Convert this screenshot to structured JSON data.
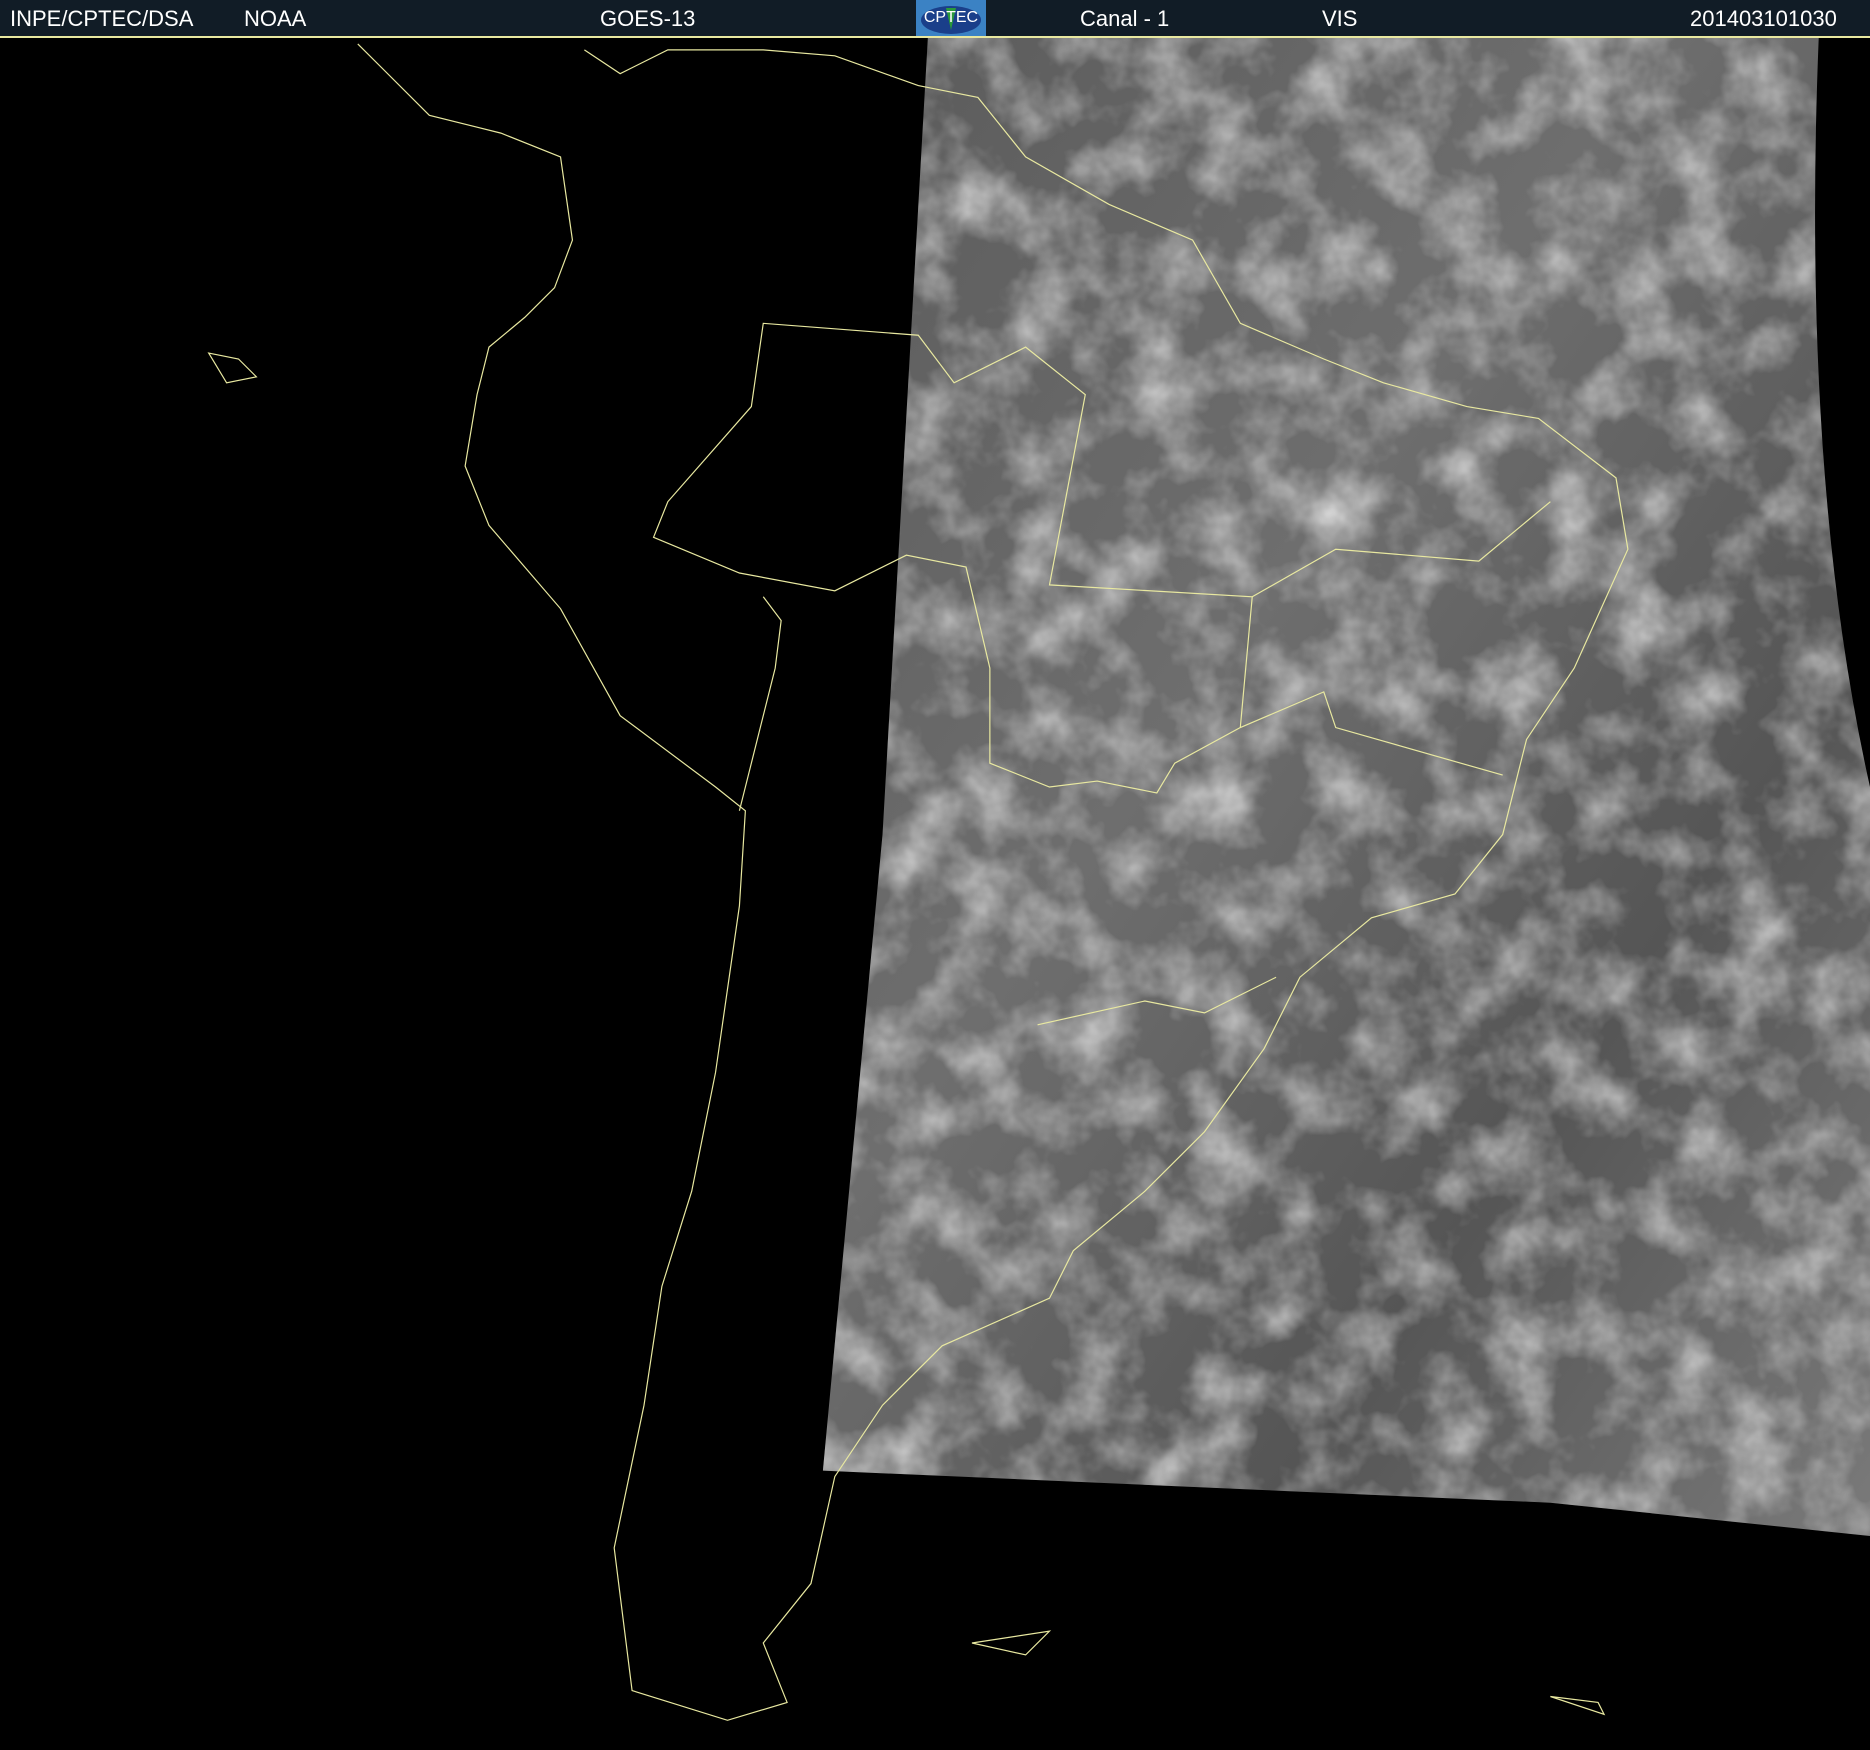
{
  "header": {
    "source": "INPE/CPTEC/DSA",
    "agency": "NOAA",
    "satellite": "GOES-13",
    "logo_text": "CPTEC",
    "channel": "Canal - 1",
    "band": "VIS",
    "timestamp": "201403101030"
  },
  "colors": {
    "header_bg": "#111c26",
    "coastline": "#e8e8a0",
    "logo_bg": "#3b82c4"
  }
}
